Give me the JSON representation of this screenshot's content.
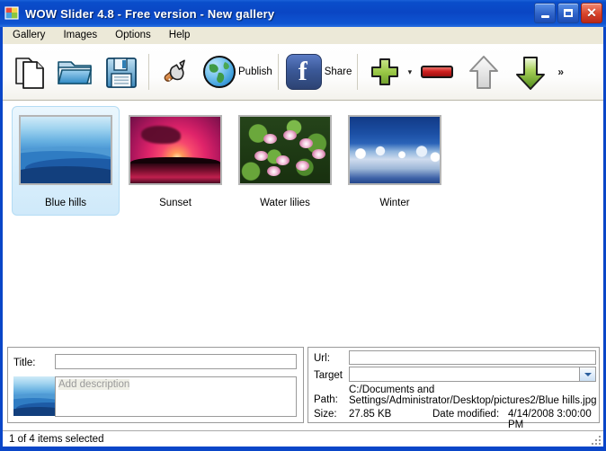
{
  "window": {
    "title": "WOW Slider 4.8 - Free version - New gallery",
    "app_icon": "wowslider-icon",
    "controls": {
      "minimize": "Minimize",
      "maximize": "Maximize",
      "close": "Close"
    }
  },
  "menu": {
    "items": [
      {
        "label": "Gallery",
        "name": "menu-gallery"
      },
      {
        "label": "Images",
        "name": "menu-images"
      },
      {
        "label": "Options",
        "name": "menu-options"
      },
      {
        "label": "Help",
        "name": "menu-help"
      }
    ]
  },
  "toolbar": {
    "new_label": "New",
    "open_label": "Open",
    "save_label": "Save",
    "properties_label": "Properties",
    "publish_label": "Publish",
    "share_label": "Share",
    "add_label": "Add images",
    "add_dropdown": "▾",
    "remove_label": "Remove",
    "move_up_label": "Move up",
    "move_down_label": "Move down",
    "overflow_label": "»",
    "icons": {
      "new": "new-document-icon",
      "open": "open-folder-icon",
      "save": "floppy-save-icon",
      "properties": "wrench-icon",
      "publish": "globe-icon",
      "share": "facebook-icon",
      "add": "green-plus-icon",
      "remove": "red-minus-icon",
      "move_up": "gray-up-arrow-icon",
      "move_down": "green-down-arrow-icon"
    }
  },
  "gallery": {
    "items": [
      {
        "caption": "Blue hills",
        "art": "bluehills",
        "selected": true
      },
      {
        "caption": "Sunset",
        "art": "sunset",
        "selected": false
      },
      {
        "caption": "Water lilies",
        "art": "lilies",
        "selected": false
      },
      {
        "caption": "Winter",
        "art": "winter",
        "selected": false
      }
    ]
  },
  "properties": {
    "title_label": "Title:",
    "title_value": "",
    "description_placeholder": "Add description",
    "description_value": "",
    "url_label": "Url:",
    "url_value": "",
    "target_label": "Target",
    "target_value": "",
    "path_label": "Path:",
    "path_value": "C:/Documents and Settings/Administrator/Desktop/pictures2/Blue hills.jpg",
    "size_label": "Size:",
    "size_value": "27.85 KB",
    "date_label": "Date modified:",
    "date_value": "4/14/2008 3:00:00 PM"
  },
  "status": {
    "text": "1 of 4 items selected"
  },
  "colors": {
    "titlebar_blue": "#0a46c4",
    "menubar": "#ece9d8",
    "selection": "#cfe9fa",
    "accent_green": "#8cc63f",
    "accent_red": "#cf2020",
    "facebook_blue": "#3b5998"
  }
}
